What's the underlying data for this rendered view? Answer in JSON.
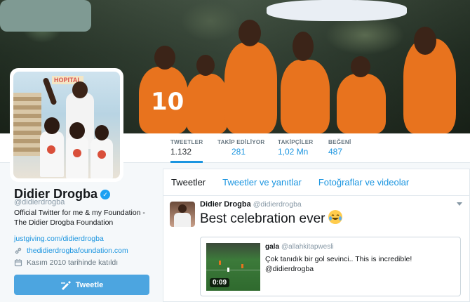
{
  "profile": {
    "name": "Didier Drogba",
    "handle": "@didierdrogba",
    "bio": "Official Twitter for me & my Foundation - The Didier Drogba Foundation",
    "bio_link": "justgiving.com/didierdrogba",
    "website": "thedidierdrogbafoundation.com",
    "joined": "Kasım 2010 tarihinde katıldı",
    "tweet_button": "Tweetle",
    "avatar_sign": "HOPITAL"
  },
  "stats": [
    {
      "label": "TWEETLER",
      "value": "1.132"
    },
    {
      "label": "TAKİP EDİLİYOR",
      "value": "281"
    },
    {
      "label": "TAKİPÇİLER",
      "value": "1,02 Mn"
    },
    {
      "label": "BEĞENİ",
      "value": "487"
    }
  ],
  "tabs": [
    "Tweetler",
    "Tweetler ve yanıtlar",
    "Fotoğraflar ve videolar"
  ],
  "tweet": {
    "name": "Didier Drogba",
    "handle": "@didierdrogba",
    "text": "Best celebration ever",
    "quote": {
      "name": "gala",
      "handle": "@allahkitapwesli",
      "text": "Çok tanıdık bir gol sevinci.. This is incredible! @didierdrogba",
      "duration": "0:09"
    }
  },
  "banner": {
    "shirt_number": "10"
  },
  "colors": {
    "accent": "#1b95e0",
    "button": "#4ca5e0",
    "jersey": "#e8731e"
  }
}
